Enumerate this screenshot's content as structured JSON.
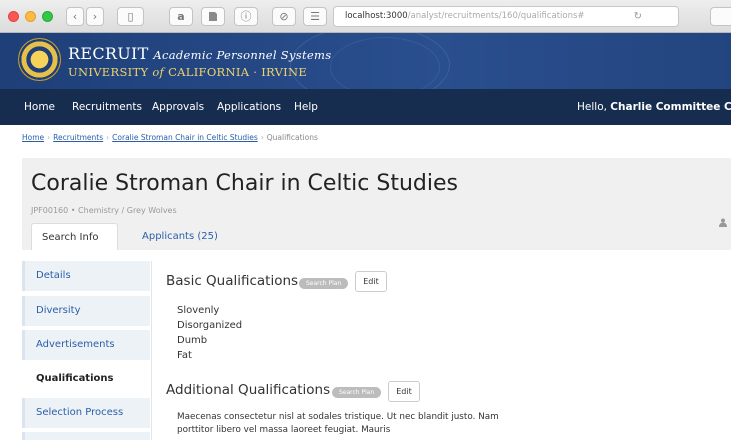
{
  "browser": {
    "url_host": "localhost:3000",
    "url_path": "/analyst/recruitments/160/qualifications#",
    "reader_icon": "a",
    "extension_icon": "pdf-icon",
    "info_icon": "ⓘ",
    "block_icon": "⊘",
    "menu_icon": "☰",
    "reload_icon": "↻"
  },
  "brand": {
    "title_recruit": "RECRUIT",
    "title_tagline": "Academic Personnel Systems",
    "sub_university": "UNIVERSITY",
    "sub_of": "of",
    "sub_campus": "CALIFORNIA · IRVINE"
  },
  "nav": {
    "items": [
      "Home",
      "Recruitments",
      "Approvals",
      "Applications",
      "Help"
    ],
    "greeting": "Hello,",
    "user": "Charlie Committee Chair"
  },
  "breadcrumb": [
    "Home",
    "Recruitments",
    "Coralie Stroman Chair in Celtic Studies",
    "Qualifications"
  ],
  "recruitment": {
    "title": "Coralie Stroman Chair in Celtic Studies",
    "meta": "JPF00160 • Chemistry / Grey Wolves",
    "tabs": [
      "Search Info",
      "Applicants (25)"
    ]
  },
  "sidebar": {
    "items": [
      "Details",
      "Diversity",
      "Advertisements",
      "Qualifications",
      "Selection Process"
    ],
    "active": "Qualifications"
  },
  "basic": {
    "title": "Basic Qualifications",
    "badge": "Search Plan",
    "edit": "Edit",
    "items": [
      "Slovenly",
      "Disorganized",
      "Dumb",
      "Fat"
    ]
  },
  "additional": {
    "title": "Additional Qualifications",
    "badge": "Search Plan",
    "edit": "Edit",
    "text": "Maecenas consectetur nisl at sodales tristique. Ut nec blandit justo. Nam porttitor libero vel massa laoreet feugiat. Mauris"
  }
}
